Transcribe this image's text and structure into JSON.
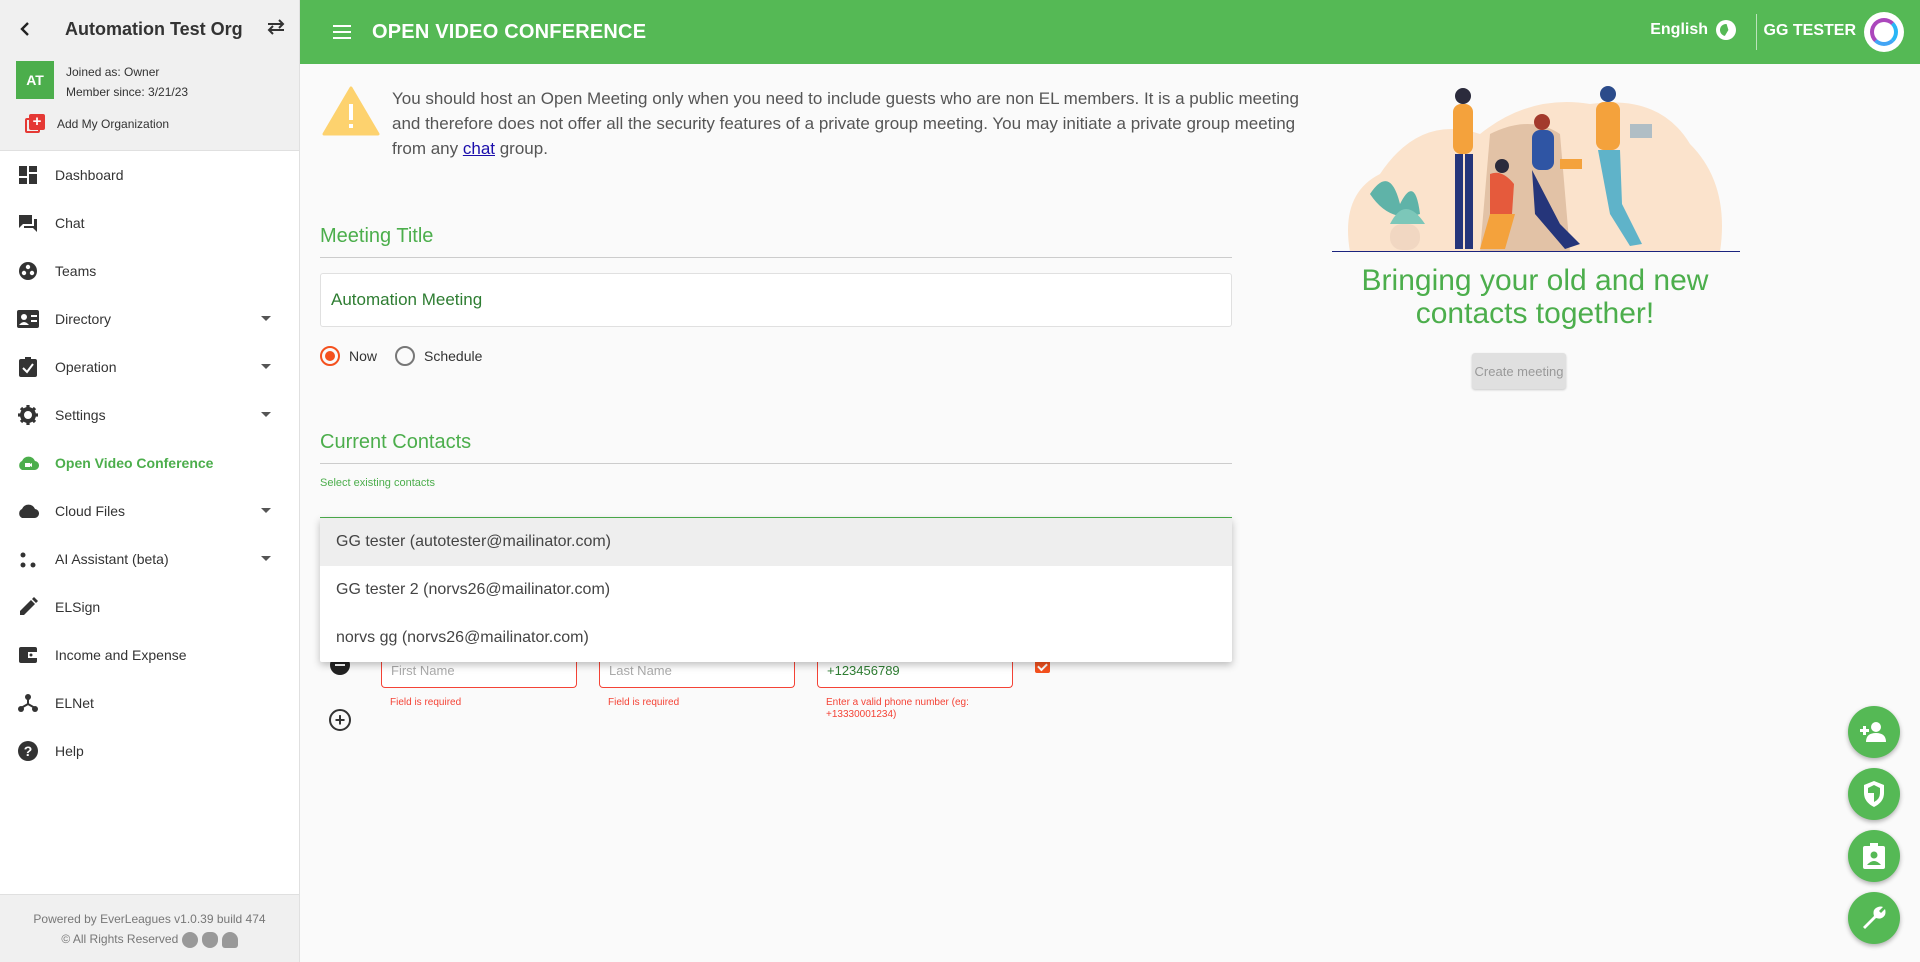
{
  "sidebar": {
    "org_name": "Automation Test Org",
    "org_initials": "AT",
    "joined_as": "Joined as: Owner",
    "member_since": "Member since: 3/21/23",
    "add_org_label": "Add My Organization",
    "items": [
      {
        "label": "Dashboard",
        "icon": "dashboard-icon",
        "caret": false
      },
      {
        "label": "Chat",
        "icon": "chat-icon",
        "caret": false
      },
      {
        "label": "Teams",
        "icon": "teams-icon",
        "caret": false
      },
      {
        "label": "Directory",
        "icon": "directory-icon",
        "caret": true
      },
      {
        "label": "Operation",
        "icon": "operation-icon",
        "caret": true
      },
      {
        "label": "Settings",
        "icon": "gear-icon",
        "caret": true
      },
      {
        "label": "Open Video Conference",
        "icon": "cloud-video-icon",
        "caret": false,
        "active": true
      },
      {
        "label": "Cloud Files",
        "icon": "cloud-icon",
        "caret": true
      },
      {
        "label": "AI Assistant (beta)",
        "icon": "ai-icon",
        "caret": true
      },
      {
        "label": "ELSign",
        "icon": "pen-icon",
        "caret": false
      },
      {
        "label": "Income and Expense",
        "icon": "wallet-icon",
        "caret": false
      },
      {
        "label": "ELNet",
        "icon": "network-icon",
        "caret": false
      },
      {
        "label": "Help",
        "icon": "help-icon",
        "caret": false
      }
    ],
    "footer_line1": "Powered by EverLeagues v1.0.39 build 474",
    "footer_line2": "© All Rights Reserved"
  },
  "header": {
    "title": "OPEN VIDEO CONFERENCE",
    "language": "English",
    "user_name": "GG TESTER"
  },
  "warning": {
    "text_before": "You should host an Open Meeting only when you need to include guests who are non EL members. It is a public meeting and therefore does not offer all the security features of a private group meeting. You may initiate a private group meeting from any ",
    "link_text": "chat",
    "text_after": " group."
  },
  "meeting": {
    "section_title": "Meeting Title",
    "title_value": "Automation Meeting",
    "radio_now": "Now",
    "radio_schedule": "Schedule",
    "selected": "Now"
  },
  "contacts": {
    "section_title": "Current Contacts",
    "select_label": "Select existing contacts",
    "options": [
      "GG tester (autotester@mailinator.com)",
      "GG tester 2 (norvs26@mailinator.com)",
      "norvs gg (norvs26@mailinator.com)"
    ],
    "first_name_placeholder": "First Name",
    "last_name_placeholder": "Last Name",
    "phone_value": "+123456789",
    "first_name_error": "Field is required",
    "last_name_error": "Field is required",
    "phone_error_line1": "Enter a valid phone number (eg:",
    "phone_error_line2": "+13330001234)"
  },
  "promo": {
    "tagline": "Bringing your old and new contacts together!",
    "create_button": "Create meeting"
  },
  "colors": {
    "brand_green": "#55b955",
    "accent_orange": "#f4511e",
    "error_red": "#f44336"
  }
}
